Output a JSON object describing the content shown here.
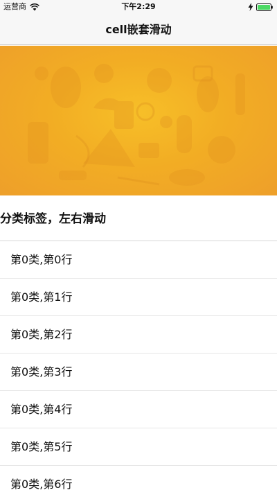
{
  "status_bar": {
    "carrier": "运营商",
    "time": "下午2:29",
    "battery_color": "#4cd964"
  },
  "nav": {
    "title": "cell嵌套滑动"
  },
  "banner": {
    "colors": {
      "center": "#f7bf28",
      "edge": "#ee9f2a"
    }
  },
  "category_header": {
    "label": "分类标签，左右滑动"
  },
  "list": {
    "items": [
      {
        "label": "第0类,第0行"
      },
      {
        "label": "第0类,第1行"
      },
      {
        "label": "第0类,第2行"
      },
      {
        "label": "第0类,第3行"
      },
      {
        "label": "第0类,第4行"
      },
      {
        "label": "第0类,第5行"
      },
      {
        "label": "第0类,第6行"
      }
    ]
  }
}
